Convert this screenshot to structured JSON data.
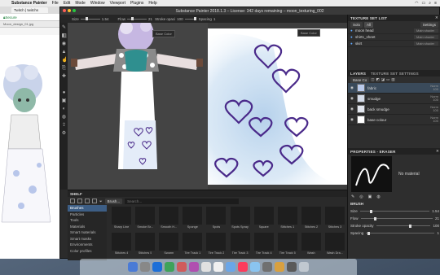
{
  "menubar": {
    "app_name": "Substance Painter",
    "items": [
      "File",
      "Edit",
      "Mode",
      "Window",
      "Viewport",
      "Plugins",
      "Help"
    ]
  },
  "browser": {
    "tab_label": "Twitch | twitchs",
    "url_text": "Secure",
    "bookmark_text": "Moon_design_01.jpg"
  },
  "window": {
    "title": "Substance Painter 2018.1.3 – License: 342 days remaining – moon_texturing_002"
  },
  "toolbar": {
    "size_label": "Size",
    "size_value": "1.54",
    "flow_label": "Flow",
    "flow_value": "21",
    "stroke_opacity_label": "Stroke opaci",
    "stroke_opacity_value": "100",
    "spacing_label": "Spacing",
    "spacing_value": "1"
  },
  "viewport": {
    "left_dropdown": "Base Color",
    "right_dropdown": "Base Color"
  },
  "texture_set_list": {
    "header": "TEXTURE SET LIST",
    "solo_label": "Solo",
    "all_label": "All",
    "settings_label": "Settings",
    "items": [
      {
        "name": "moon head",
        "shader": "Main shader"
      },
      {
        "name": "shirt1_sheet",
        "shader": "Main shader"
      },
      {
        "name": "skirt",
        "shader": "Main shader"
      }
    ]
  },
  "layers": {
    "tab_layers": "LAYERS",
    "tab_tss": "TEXTURE SET SETTINGS",
    "channel_dropdown": "Base Co",
    "rows": [
      {
        "name": "fabric",
        "blend": "Norm",
        "opacity": "100"
      },
      {
        "name": "smudge",
        "blend": "Norm",
        "opacity": "100"
      },
      {
        "name": "back smudge",
        "blend": "Norm",
        "opacity": "100"
      },
      {
        "name": "base colour",
        "blend": "Norm",
        "opacity": "100"
      }
    ]
  },
  "properties": {
    "header": "PROPERTIES - ERASER",
    "material_label": "No material",
    "brush_label": "BRUSH",
    "size_label": "Size",
    "size_value": "1.54",
    "flow_label": "Flow",
    "flow_value": "21",
    "stroke_opacity_label": "Stroke opacity",
    "stroke_opacity_value": "100",
    "spacing_label": "Spacing",
    "spacing_value": "1"
  },
  "shelf": {
    "header": "SHELF",
    "filter_chip": "Brush...",
    "search_placeholder": "Search...",
    "categories": [
      "Brushes",
      "Particles",
      "Tools",
      "Materials",
      "Smart materials",
      "Smart masks",
      "Environments",
      "Color profiles"
    ],
    "brushes": [
      "Sharp Line",
      "Smoke Br...",
      "Smooth H...",
      "Sponge",
      "Spots",
      "Spots Spray",
      "Square",
      "Stitches 1",
      "Stitches 2",
      "Stitches 3",
      "Stitches 4",
      "Stitches 5",
      "Swarm",
      "Tire Track 1",
      "Tire Track 2",
      "Tire Track 3",
      "Tire Track 4",
      "Tire Track 5",
      "Wash",
      "Wash Dra..."
    ]
  },
  "colors": {
    "accent_blue": "#3d5e85",
    "heart_stroke": "#4a2a8a",
    "skirt_wash": "#a9c9e8"
  }
}
